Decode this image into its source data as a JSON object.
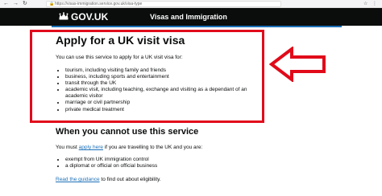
{
  "browser": {
    "url": "https://visas-immigration.service.gov.uk/visa-type",
    "lock_glyph": "🔒",
    "back_glyph": "←",
    "forward_glyph": "→",
    "reload_glyph": "↻",
    "toolbar_glyphs": "☆ ⋮"
  },
  "header": {
    "brand": "GOV.UK",
    "service_name": "Visas and Immigration",
    "background": "#0b0c0c",
    "rule_color": "#1d70b8"
  },
  "main": {
    "title": "Apply for a UK visit visa",
    "intro": "You can use this service to apply for a UK visit visa for:",
    "uses": [
      "tourism, including visiting family and friends",
      "business, including sports and entertainment",
      "transit through the UK",
      "academic visit, including teaching, exchange and visiting as a dependant of an academic visitor",
      "marriage or civil partnership",
      "private medical treatment"
    ]
  },
  "cannot": {
    "title": "When you cannot use this service",
    "must_prefix": "You must ",
    "apply_link": "apply here",
    "must_suffix": " if you are travelling to the UK and you are:",
    "items": [
      "exempt from UK immigration control",
      "a diplomat or official on official business"
    ],
    "guidance_link": "Read the guidance",
    "guidance_suffix": " to find out about eligibility."
  },
  "annotation": {
    "color": "#e10a1a",
    "arrow_icon": "left-arrow"
  }
}
